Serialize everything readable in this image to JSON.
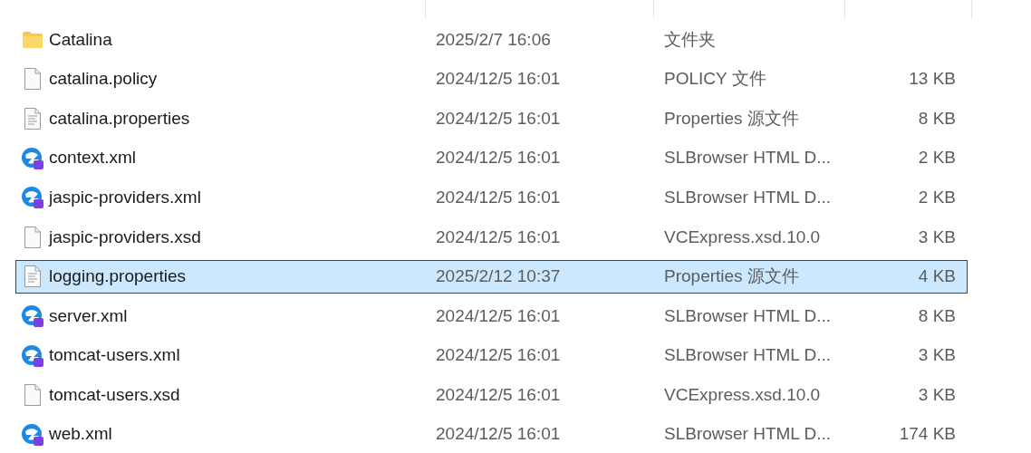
{
  "files": [
    {
      "name": "Catalina",
      "modified": "2025/2/7 16:06",
      "type": "文件夹",
      "kind": "folder",
      "selected": false
    },
    {
      "name": "catalina.policy",
      "modified": "2024/12/5 16:01",
      "type": "POLICY 文件",
      "size": "13 KB",
      "kind": "file",
      "selected": false
    },
    {
      "name": "catalina.properties",
      "modified": "2024/12/5 16:01",
      "type": "Properties 源文件",
      "size": "8 KB",
      "kind": "text",
      "selected": false
    },
    {
      "name": "context.xml",
      "modified": "2024/12/5 16:01",
      "type": "SLBrowser HTML D...",
      "size": "2 KB",
      "kind": "browser",
      "selected": false
    },
    {
      "name": "jaspic-providers.xml",
      "modified": "2024/12/5 16:01",
      "type": "SLBrowser HTML D...",
      "size": "2 KB",
      "kind": "browser",
      "selected": false
    },
    {
      "name": "jaspic-providers.xsd",
      "modified": "2024/12/5 16:01",
      "type": "VCExpress.xsd.10.0",
      "size": "3 KB",
      "kind": "file",
      "selected": false
    },
    {
      "name": "logging.properties",
      "modified": "2025/2/12 10:37",
      "type": "Properties 源文件",
      "size": "4 KB",
      "kind": "text",
      "selected": true
    },
    {
      "name": "server.xml",
      "modified": "2024/12/5 16:01",
      "type": "SLBrowser HTML D...",
      "size": "8 KB",
      "kind": "browser",
      "selected": false
    },
    {
      "name": "tomcat-users.xml",
      "modified": "2024/12/5 16:01",
      "type": "SLBrowser HTML D...",
      "size": "3 KB",
      "kind": "browser",
      "selected": false
    },
    {
      "name": "tomcat-users.xsd",
      "modified": "2024/12/5 16:01",
      "type": "VCExpress.xsd.10.0",
      "size": "3 KB",
      "kind": "file",
      "selected": false
    },
    {
      "name": "web.xml",
      "modified": "2024/12/5 16:01",
      "type": "SLBrowser HTML D...",
      "size": "174 KB",
      "kind": "browser",
      "selected": false
    }
  ]
}
